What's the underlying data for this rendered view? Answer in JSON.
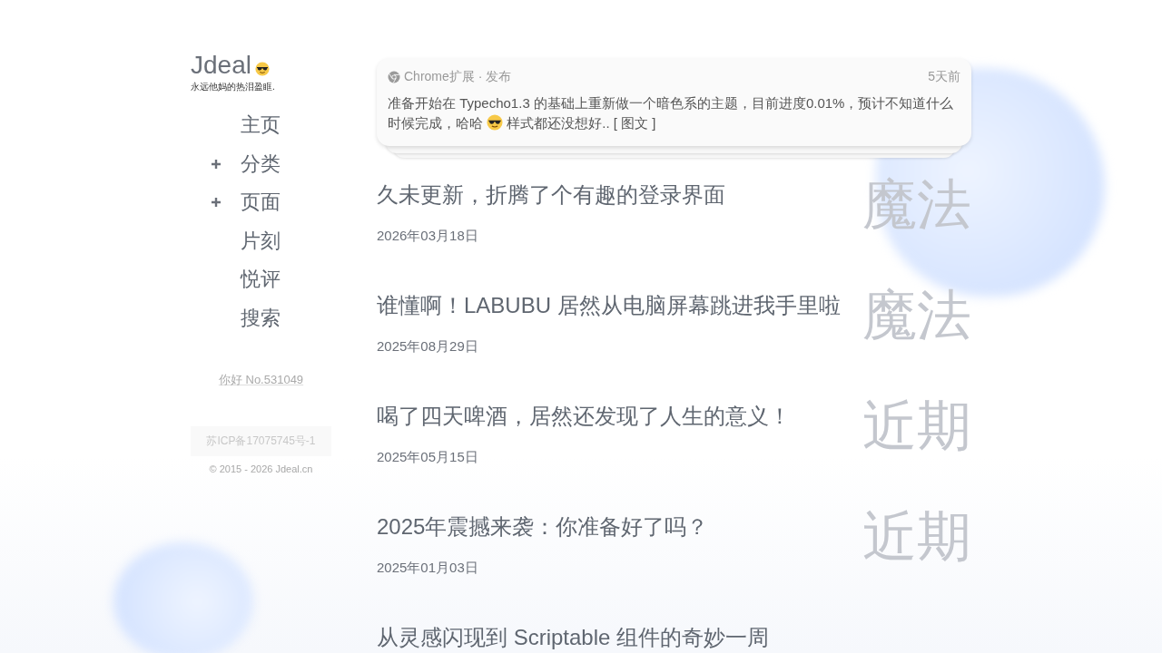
{
  "site": {
    "title": "Jdeal",
    "tagline": "永远他妈的热泪盈眶."
  },
  "nav": [
    {
      "label": "主页",
      "expandable": false
    },
    {
      "label": "分类",
      "expandable": true
    },
    {
      "label": "页面",
      "expandable": true
    },
    {
      "label": "片刻",
      "expandable": false
    },
    {
      "label": "悦评",
      "expandable": false
    },
    {
      "label": "搜索",
      "expandable": false
    }
  ],
  "visitor": "你好 No.531049",
  "icp": "苏ICP备17075745号-1",
  "copyright": "© 2015 - 2026 Jdeal.cn",
  "moment": {
    "source": "Chrome扩展 · 发布",
    "time": "5天前",
    "text_before": "准备开始在 Typecho1.3 的基础上重新做一个暗色系的主题，目前进度0.01%，预计不知道什么时候完成，哈哈",
    "text_after": "样式都还没想好.. [ 图文 ]"
  },
  "posts": [
    {
      "title": "久未更新，折腾了个有趣的登录界面",
      "date": "2026年03月18日",
      "category": "魔法"
    },
    {
      "title": "谁懂啊！LABUBU 居然从电脑屏幕跳进我手里啦",
      "date": "2025年08月29日",
      "category": "魔法"
    },
    {
      "title": "喝了四天啤酒，居然还发现了人生的意义！",
      "date": "2025年05月15日",
      "category": "近期"
    },
    {
      "title": "2025年震撼来袭：你准备好了吗？",
      "date": "2025年01月03日",
      "category": "近期"
    },
    {
      "title": "从灵感闪现到 Scriptable 组件的奇妙一周"
    }
  ]
}
